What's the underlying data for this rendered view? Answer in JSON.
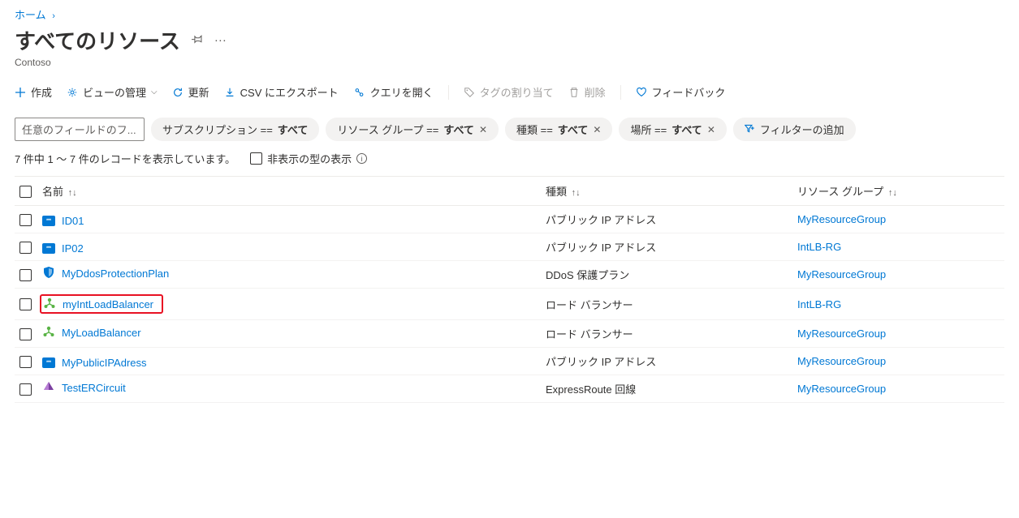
{
  "breadcrumb": {
    "home": "ホーム"
  },
  "page": {
    "title": "すべてのリソース",
    "subtitle": "Contoso"
  },
  "toolbar": {
    "create": "作成",
    "manage_view": "ビューの管理",
    "refresh": "更新",
    "export_csv": "CSV にエクスポート",
    "open_query": "クエリを開く",
    "assign_tags": "タグの割り当て",
    "delete": "削除",
    "feedback": "フィードバック"
  },
  "filters": {
    "search_placeholder": "任意のフィールドのフ...",
    "subscription": {
      "label": "サブスクリプション == ",
      "value": "すべて"
    },
    "resource_group": {
      "label": "リソース グループ == ",
      "value": "すべて"
    },
    "type": {
      "label": "種類 == ",
      "value": "すべて"
    },
    "location": {
      "label": "場所 == ",
      "value": "すべて"
    },
    "add_filter": "フィルターの追加"
  },
  "status": {
    "records": "7 件中 1 ～ 7 件のレコードを表示しています。",
    "show_hidden": "非表示の型の表示"
  },
  "columns": {
    "name": "名前",
    "type": "種類",
    "resource_group": "リソース グループ"
  },
  "rows": [
    {
      "icon": "ip",
      "name": "ID01",
      "type": "パブリック IP アドレス",
      "rg": "MyResourceGroup",
      "highlight": false
    },
    {
      "icon": "ip",
      "name": "IP02",
      "type": "パブリック IP アドレス",
      "rg": "IntLB-RG",
      "highlight": false
    },
    {
      "icon": "shield",
      "name": "MyDdosProtectionPlan",
      "type": "DDoS 保護プラン",
      "rg": "MyResourceGroup",
      "highlight": false
    },
    {
      "icon": "lb",
      "name": "myIntLoadBalancer",
      "type": "ロード バランサー",
      "rg": "IntLB-RG",
      "highlight": true
    },
    {
      "icon": "lb",
      "name": "MyLoadBalancer",
      "type": "ロード バランサー",
      "rg": "MyResourceGroup",
      "highlight": false
    },
    {
      "icon": "ip",
      "name": "MyPublicIPAdress",
      "type": "パブリック IP アドレス",
      "rg": "MyResourceGroup",
      "highlight": false
    },
    {
      "icon": "er",
      "name": "TestERCircuit",
      "type": "ExpressRoute 回線",
      "rg": "MyResourceGroup",
      "highlight": false
    }
  ]
}
